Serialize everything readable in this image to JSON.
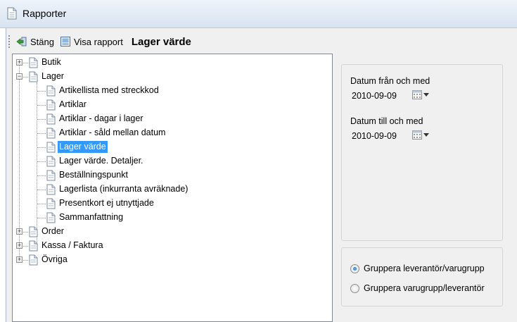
{
  "window": {
    "title": "Rapporter"
  },
  "toolbar": {
    "close_label": "Stäng",
    "show_report_label": "Visa rapport",
    "report_title": "Lager värde"
  },
  "tree": {
    "nodes": [
      {
        "label": "Butik",
        "expander": "+"
      },
      {
        "label": "Lager",
        "expander": "−"
      },
      {
        "label": "Artikellista med streckkod"
      },
      {
        "label": "Artiklar"
      },
      {
        "label": "Artiklar - dagar i lager"
      },
      {
        "label": "Artiklar - såld mellan datum"
      },
      {
        "label": "Lager värde",
        "selected": true
      },
      {
        "label": "Lager värde. Detaljer."
      },
      {
        "label": "Beställningspunkt"
      },
      {
        "label": "Lagerlista (inkurranta avräknade)"
      },
      {
        "label": "Presentkort ej utnyttjade"
      },
      {
        "label": "Sammanfattning"
      },
      {
        "label": "Order",
        "expander": "+"
      },
      {
        "label": "Kassa / Faktura",
        "expander": "+"
      },
      {
        "label": "Övriga",
        "expander": "+"
      }
    ]
  },
  "dates": {
    "from_label": "Datum från och med",
    "from_value": "2010-09-09",
    "to_label": "Datum till och med",
    "to_value": "2010-09-09"
  },
  "grouping": {
    "option1": "Gruppera leverantör/varugrupp",
    "option2": "Gruppera varugrupp/leverantör",
    "selected": "option1"
  },
  "colors": {
    "selection": "#3399ff",
    "title_gradient_top": "#eef3fa"
  }
}
